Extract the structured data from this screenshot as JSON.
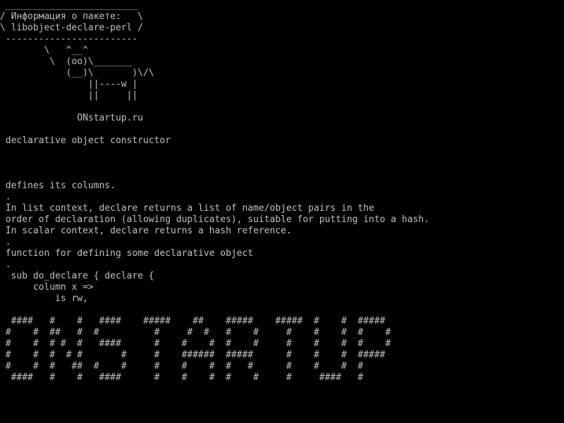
{
  "colors": {
    "background": "#000000",
    "foreground": "#c0c0c0"
  },
  "terminal": {
    "lines": [
      " ________________________",
      "/ Информация о пакете:   \\",
      "\\ libobject-declare-perl /",
      " ------------------------",
      "        \\   ^__^",
      "         \\  (oo)\\_______",
      "            (__)\\       )\\/\\",
      "                ||----w |",
      "                ||     ||",
      "",
      "              ONstartup.ru",
      "",
      " declarative object constructor",
      "",
      "",
      "",
      " defines its columns.",
      " .",
      " In list context, declare returns a list of name/object pairs in the",
      " order of declaration (allowing duplicates), suitable for putting into a hash.",
      " In scalar context, declare returns a hash reference.",
      " .",
      " function for defining some declarative object",
      " .",
      "  sub do_declare { declare {",
      "      column x =>",
      "          is rw,",
      "",
      "  ####   #    #   ####    #####    ##    #####    #####  #    #  #####",
      " #    #  ##   #  #          #     #  #   #    #     #    #    #  #    #",
      " #    #  # #  #   ####      #    #    #  #    #     #    #    #  #    #",
      " #    #  #  # #       #     #    ######  #####      #    #    #  #####",
      " #    #  #   ##  #    #     #    #    #  #   #      #    #    #  #",
      "  ####   #    #   ####      #    #    #  #    #     #     ####   #"
    ]
  }
}
